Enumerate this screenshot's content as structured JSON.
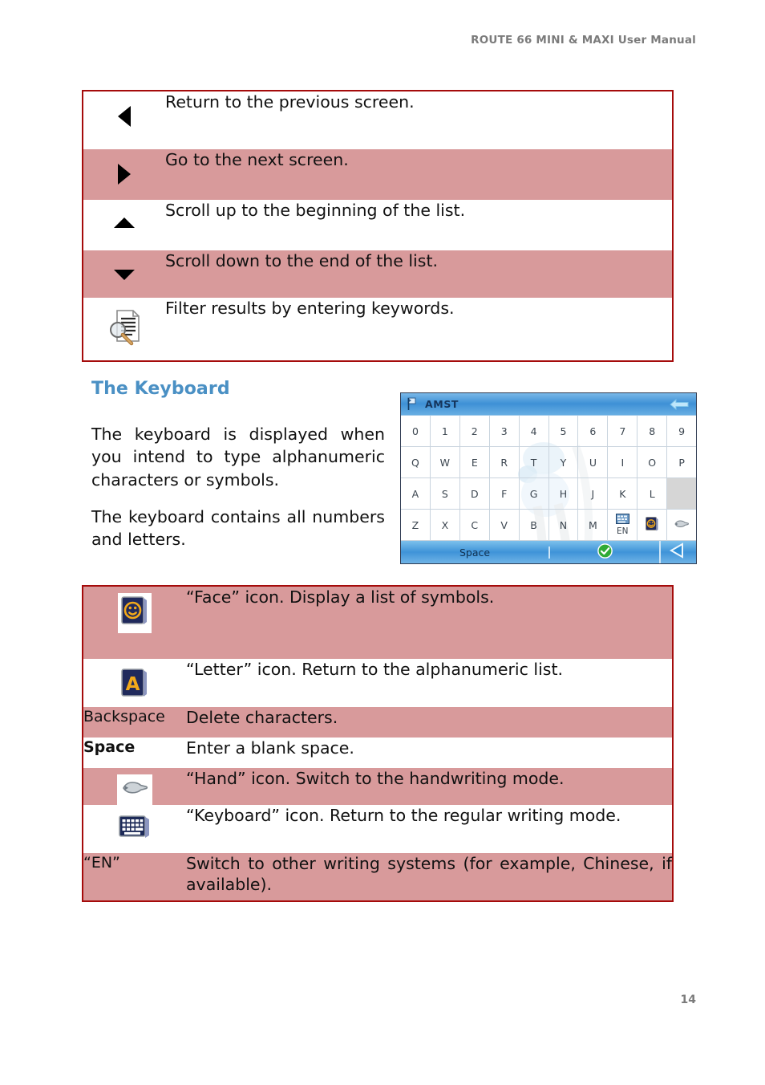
{
  "header": {
    "title": "ROUTE 66 MINI & MAXI User Manual"
  },
  "footer": {
    "page_number": "14"
  },
  "colors": {
    "row_shaded": "#d89a9b",
    "table_border": "#a50b0b",
    "heading_blue": "#4a90c4",
    "header_gray": "#7b7b7b"
  },
  "navigation_table": {
    "rows": [
      {
        "icon": "triangle-left-icon",
        "shaded": false,
        "description": "Return to the previous screen."
      },
      {
        "icon": "triangle-right-icon",
        "shaded": true,
        "description": "Go to the next screen."
      },
      {
        "icon": "triangle-up-icon",
        "shaded": false,
        "description": "Scroll up to the beginning of the list."
      },
      {
        "icon": "triangle-down-icon",
        "shaded": true,
        "description": "Scroll down to the end of the list."
      },
      {
        "icon": "filter-document-icon",
        "shaded": false,
        "description": "Filter results by entering keywords."
      }
    ]
  },
  "keyboard_section": {
    "heading": "The Keyboard",
    "paragraphs": [
      "The keyboard is displayed when you intend to type alphanumeric characters or symbols.",
      "The keyboard contains all numbers and letters."
    ]
  },
  "device_screenshot": {
    "title": "AMST",
    "title_icon": "flag-pin-icon",
    "back_icon": "back-arrow-icon",
    "rows": [
      {
        "keys": [
          "0",
          "1",
          "2",
          "3",
          "4",
          "5",
          "6",
          "7",
          "8",
          "9"
        ]
      },
      {
        "keys": [
          "Q",
          "W",
          "E",
          "R",
          "T",
          "Y",
          "U",
          "I",
          "O",
          "P"
        ]
      },
      {
        "keys": [
          "A",
          "S",
          "D",
          "F",
          "G",
          "H",
          "J",
          "K",
          "L",
          ""
        ]
      },
      {
        "keys": [
          "Z",
          "X",
          "C",
          "V",
          "B",
          "N",
          "M",
          "EN",
          "face",
          "hand"
        ]
      }
    ],
    "blank_key_index": 9,
    "en_key_label": "EN",
    "en_key_icon": "writing-systems-icon",
    "face_key_icon": "face-icon",
    "hand_key_icon": "hand-icon",
    "space_label": "Space",
    "ok_icon": "green-check-icon",
    "enter_icon": "enter-arrow-icon"
  },
  "keyboard_icons_table": {
    "rows": [
      {
        "label": "",
        "label_bold": false,
        "icon": "face-icon",
        "shaded": true,
        "description": "“Face” icon. Display a list of symbols."
      },
      {
        "label": "",
        "label_bold": false,
        "icon": "letter-a-icon",
        "shaded": false,
        "description": "“Letter” icon. Return to the alphanumeric list."
      },
      {
        "label": "Backspace",
        "label_bold": false,
        "icon": "",
        "shaded": true,
        "description": "Delete characters."
      },
      {
        "label": "Space",
        "label_bold": true,
        "icon": "",
        "shaded": false,
        "description": "Enter a blank space."
      },
      {
        "label": "",
        "label_bold": false,
        "icon": "hand-icon",
        "shaded": true,
        "description": "“Hand” icon. Switch to the handwriting mode."
      },
      {
        "label": "",
        "label_bold": false,
        "icon": "keyboard-icon",
        "shaded": false,
        "description": "“Keyboard” icon. Return to the regular writing mode."
      },
      {
        "label": "“EN”",
        "label_bold": false,
        "icon": "",
        "shaded": true,
        "description": "Switch to other writing systems (for example, Chinese, if available)."
      }
    ]
  }
}
